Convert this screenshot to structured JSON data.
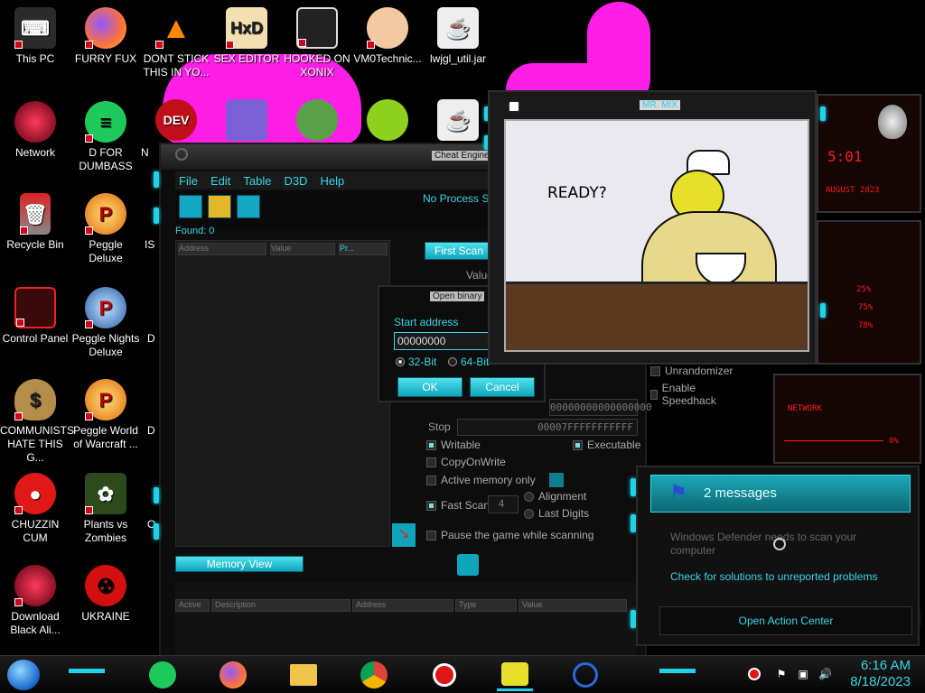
{
  "desktop_icons": [
    {
      "label": "This PC",
      "icon": "this-pc-icon"
    },
    {
      "label": "FURRY FUX",
      "icon": "firefox-icon"
    },
    {
      "label": "DONT STICK THIS IN YO...",
      "icon": "vlc-cone-icon"
    },
    {
      "label": "SEX EDITOR",
      "icon": "hxd-editor-icon"
    },
    {
      "label": "HOOKED ON XONIX",
      "icon": "xonix-game-icon"
    },
    {
      "label": "VM0Technic...",
      "icon": "doctor-avatar-icon"
    },
    {
      "label": "lwjgl_util.jar",
      "icon": "java-jar-icon"
    },
    {
      "label": "Network",
      "icon": "network-icon"
    },
    {
      "label": "D FOR DUMBASS",
      "icon": "green-chat-icon"
    },
    {
      "label": "N",
      "icon": "devcpp-icon"
    },
    {
      "label": "Recycle Bin",
      "icon": "recycle-bin-icon"
    },
    {
      "label": "Peggle Deluxe",
      "icon": "peggle-icon"
    },
    {
      "label": "IS",
      "icon": "partial-icon"
    },
    {
      "label": "Control Panel",
      "icon": "control-panel-icon"
    },
    {
      "label": "Peggle Nights Deluxe",
      "icon": "peggle-nights-icon"
    },
    {
      "label": "D",
      "icon": "partial-icon"
    },
    {
      "label": "COMMUNISTS HATE THIS G...",
      "icon": "money-bag-icon"
    },
    {
      "label": "Peggle World of Warcraft ...",
      "icon": "peggle-wow-icon"
    },
    {
      "label": "D",
      "icon": "partial-icon"
    },
    {
      "label": "CHUZZIN CUM",
      "icon": "chuzzle-icon"
    },
    {
      "label": "Plants vs Zombies",
      "icon": "plants-zombies-icon"
    },
    {
      "label": "O",
      "icon": "partial-icon"
    },
    {
      "label": "Download Black Ali...",
      "icon": "alien-download-icon"
    },
    {
      "label": "UKRAINE",
      "icon": "radiation-icon"
    }
  ],
  "cheat_engine": {
    "title": "Cheat Engine",
    "menu": [
      "File",
      "Edit",
      "Table",
      "D3D",
      "Help"
    ],
    "process": "No Process Se",
    "found": "Found: 0",
    "list_headers": [
      "Address",
      "Value",
      "Pr..."
    ],
    "first_scan": "First Scan",
    "value_label": "Value",
    "stop_label": "Stop",
    "start_value": "00000000000000000",
    "stop_value": "00007FFFFFFFFFFF",
    "unrandomizer": "Unrandomizer",
    "enable_speedhack": "Enable Speedhack",
    "writable": "Writable",
    "executable": "Executable",
    "copy_on_write": "CopyOnWrite",
    "active_memory": "Active memory only",
    "fast_scan": "Fast Scan",
    "fast_scan_value": "4",
    "alignment": "Alignment",
    "last_digits": "Last Digits",
    "pause_game": "Pause the game while scanning",
    "memory_view": "Memory View",
    "bottom_headers": [
      "Active",
      "Description",
      "Address",
      "Type",
      "Value"
    ]
  },
  "dialog": {
    "title": "Open binary",
    "start_address_label": "Start address",
    "start_address_value": "00000000",
    "bit32": "32-Bit",
    "bit64": "64-Bit",
    "ok": "OK",
    "cancel": "Cancel"
  },
  "mr_mix": {
    "title": "MR. MIX",
    "speech": "READY?"
  },
  "gadgets": {
    "clock_time": "5:01",
    "clock_date": "AUGUST 2023",
    "cpu": [
      "25%",
      "75%",
      "78%"
    ],
    "network_label": "NETWORK",
    "network_value": "0%"
  },
  "notification": {
    "header": "2 messages",
    "message": "Windows Defender needs to scan your computer",
    "link": "Check for solutions to unreported problems",
    "open_action_center": "Open Action Center"
  },
  "taskbar": {
    "time": "6:16 AM",
    "date": "8/18/2023"
  }
}
